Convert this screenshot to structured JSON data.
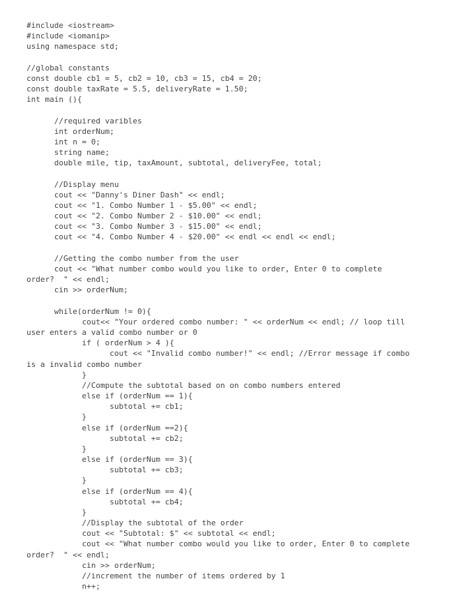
{
  "code": {
    "lines": [
      "#include <iostream>",
      "#include <iomanip>",
      "using namespace std;",
      "",
      "//global constants",
      "const double cb1 = 5, cb2 = 10, cb3 = 15, cb4 = 20;",
      "const double taxRate = 5.5, deliveryRate = 1.50;",
      "int main (){",
      "",
      "      //required varibles",
      "      int orderNum;",
      "      int n = 0;",
      "      string name;",
      "      double mile, tip, taxAmount, subtotal, deliveryFee, total;",
      "",
      "      //Display menu",
      "      cout << \"Danny's Diner Dash\" << endl;",
      "      cout << \"1. Combo Number 1 - $5.00\" << endl;",
      "      cout << \"2. Combo Number 2 - $10.00\" << endl;",
      "      cout << \"3. Combo Number 3 - $15.00\" << endl;",
      "      cout << \"4. Combo Number 4 - $20.00\" << endl << endl << endl;",
      "",
      "      //Getting the combo number from the user",
      "      cout << \"What number combo would you like to order, Enter 0 to complete",
      "order?  \" << endl;",
      "      cin >> orderNum;",
      "",
      "      while(orderNum != 0){",
      "            cout<< \"Your ordered combo number: \" << orderNum << endl; // loop till",
      "user enters a valid combo number or 0",
      "            if ( orderNum > 4 ){",
      "                  cout << \"Invalid combo number!\" << endl; //Error message if combo",
      "is a invalid combo number",
      "            }",
      "            //Compute the subtotal based on on combo numbers entered",
      "            else if (orderNum == 1){",
      "                  subtotal += cb1;",
      "            }",
      "            else if (orderNum ==2){",
      "                  subtotal += cb2;",
      "            }",
      "            else if (orderNum == 3){",
      "                  subtotal += cb3;",
      "            }",
      "            else if (orderNum == 4){",
      "                  subtotal += cb4;",
      "            }",
      "            //Display the subtotal of the order",
      "            cout << \"Subtotal: $\" << subtotal << endl;",
      "            cout << \"What number combo would you like to order, Enter 0 to complete",
      "order?  \" << endl;",
      "            cin >> orderNum;",
      "            //increment the number of items ordered by 1",
      "            n++;"
    ]
  }
}
